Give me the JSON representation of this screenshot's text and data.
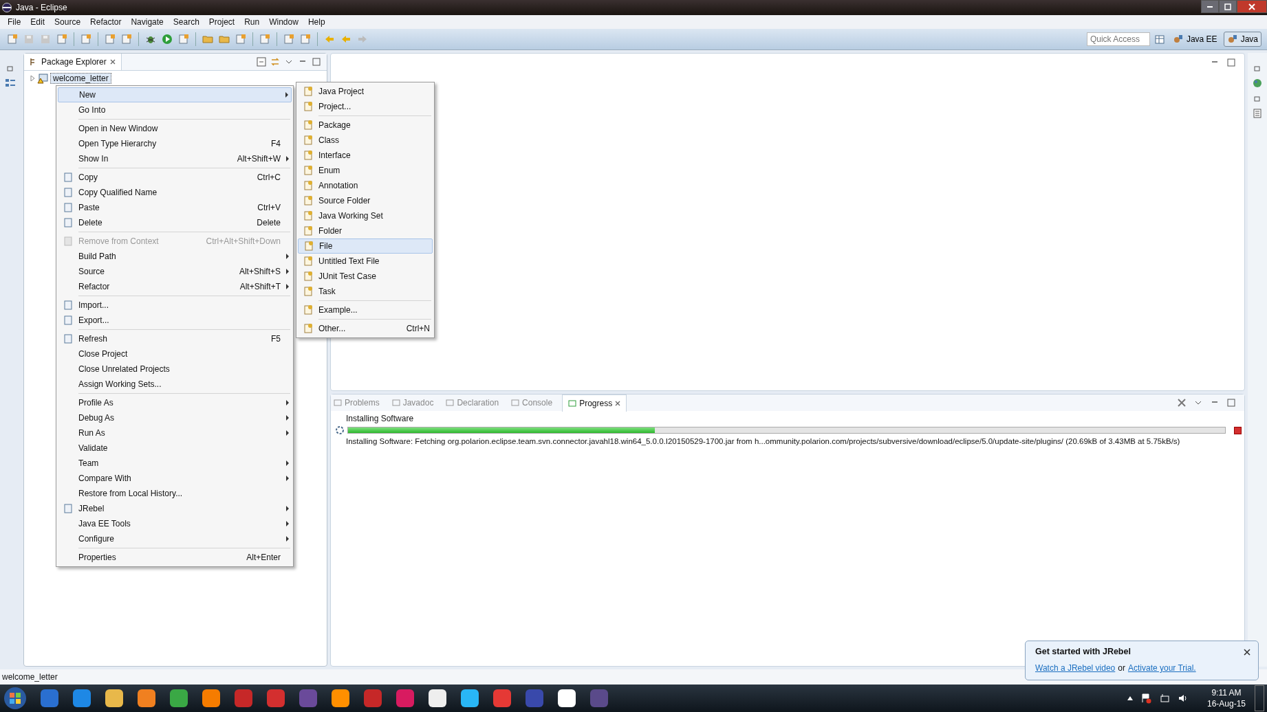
{
  "window": {
    "title": "Java - Eclipse"
  },
  "menubar": [
    "File",
    "Edit",
    "Source",
    "Refactor",
    "Navigate",
    "Search",
    "Project",
    "Run",
    "Window",
    "Help"
  ],
  "quick_access": {
    "placeholder": "Quick Access"
  },
  "perspectives": [
    {
      "label": "Java EE",
      "selected": false
    },
    {
      "label": "Java",
      "selected": true
    }
  ],
  "package_explorer": {
    "title": "Package Explorer",
    "tree": [
      {
        "label": "welcome_letter",
        "expanded": false,
        "selected": true
      }
    ]
  },
  "context_menu": {
    "items": [
      {
        "kind": "item",
        "label": "New",
        "submenu": true,
        "disabled": false,
        "icon": false,
        "selected": true
      },
      {
        "kind": "item",
        "label": "Go Into",
        "submenu": false,
        "disabled": false,
        "icon": false,
        "selected": false
      },
      {
        "kind": "separator"
      },
      {
        "kind": "item",
        "label": "Open in New Window",
        "submenu": false,
        "disabled": false,
        "icon": false,
        "selected": false
      },
      {
        "kind": "item",
        "label": "Open Type Hierarchy",
        "shortcut": "F4",
        "submenu": false,
        "disabled": false,
        "icon": false,
        "selected": false
      },
      {
        "kind": "item",
        "label": "Show In",
        "shortcut": "Alt+Shift+W",
        "submenu": true,
        "disabled": false,
        "icon": false,
        "selected": false
      },
      {
        "kind": "separator"
      },
      {
        "kind": "item",
        "label": "Copy",
        "shortcut": "Ctrl+C",
        "submenu": false,
        "disabled": false,
        "icon": true,
        "selected": false
      },
      {
        "kind": "item",
        "label": "Copy Qualified Name",
        "submenu": false,
        "disabled": false,
        "icon": true,
        "selected": false
      },
      {
        "kind": "item",
        "label": "Paste",
        "shortcut": "Ctrl+V",
        "submenu": false,
        "disabled": false,
        "icon": true,
        "selected": false
      },
      {
        "kind": "item",
        "label": "Delete",
        "shortcut": "Delete",
        "submenu": false,
        "disabled": false,
        "icon": true,
        "selected": false
      },
      {
        "kind": "separator"
      },
      {
        "kind": "item",
        "label": "Remove from Context",
        "shortcut": "Ctrl+Alt+Shift+Down",
        "submenu": false,
        "disabled": true,
        "icon": true,
        "selected": false
      },
      {
        "kind": "item",
        "label": "Build Path",
        "submenu": true,
        "disabled": false,
        "icon": false,
        "selected": false
      },
      {
        "kind": "item",
        "label": "Source",
        "shortcut": "Alt+Shift+S",
        "submenu": true,
        "disabled": false,
        "icon": false,
        "selected": false
      },
      {
        "kind": "item",
        "label": "Refactor",
        "shortcut": "Alt+Shift+T",
        "submenu": true,
        "disabled": false,
        "icon": false,
        "selected": false
      },
      {
        "kind": "separator"
      },
      {
        "kind": "item",
        "label": "Import...",
        "submenu": false,
        "disabled": false,
        "icon": true,
        "selected": false
      },
      {
        "kind": "item",
        "label": "Export...",
        "submenu": false,
        "disabled": false,
        "icon": true,
        "selected": false
      },
      {
        "kind": "separator"
      },
      {
        "kind": "item",
        "label": "Refresh",
        "shortcut": "F5",
        "submenu": false,
        "disabled": false,
        "icon": true,
        "selected": false
      },
      {
        "kind": "item",
        "label": "Close Project",
        "submenu": false,
        "disabled": false,
        "icon": false,
        "selected": false
      },
      {
        "kind": "item",
        "label": "Close Unrelated Projects",
        "submenu": false,
        "disabled": false,
        "icon": false,
        "selected": false
      },
      {
        "kind": "item",
        "label": "Assign Working Sets...",
        "submenu": false,
        "disabled": false,
        "icon": false,
        "selected": false
      },
      {
        "kind": "separator"
      },
      {
        "kind": "item",
        "label": "Profile As",
        "submenu": true,
        "disabled": false,
        "icon": false,
        "selected": false
      },
      {
        "kind": "item",
        "label": "Debug As",
        "submenu": true,
        "disabled": false,
        "icon": false,
        "selected": false
      },
      {
        "kind": "item",
        "label": "Run As",
        "submenu": true,
        "disabled": false,
        "icon": false,
        "selected": false
      },
      {
        "kind": "item",
        "label": "Validate",
        "submenu": false,
        "disabled": false,
        "icon": false,
        "selected": false
      },
      {
        "kind": "item",
        "label": "Team",
        "submenu": true,
        "disabled": false,
        "icon": false,
        "selected": false
      },
      {
        "kind": "item",
        "label": "Compare With",
        "submenu": true,
        "disabled": false,
        "icon": false,
        "selected": false
      },
      {
        "kind": "item",
        "label": "Restore from Local History...",
        "submenu": false,
        "disabled": false,
        "icon": false,
        "selected": false
      },
      {
        "kind": "item",
        "label": "JRebel",
        "submenu": true,
        "disabled": false,
        "icon": true,
        "selected": false
      },
      {
        "kind": "item",
        "label": "Java EE Tools",
        "submenu": true,
        "disabled": false,
        "icon": false,
        "selected": false
      },
      {
        "kind": "item",
        "label": "Configure",
        "submenu": true,
        "disabled": false,
        "icon": false,
        "selected": false
      },
      {
        "kind": "separator"
      },
      {
        "kind": "item",
        "label": "Properties",
        "shortcut": "Alt+Enter",
        "submenu": false,
        "disabled": false,
        "icon": false,
        "selected": false
      }
    ]
  },
  "new_submenu": {
    "items": [
      {
        "kind": "item",
        "label": "Java Project",
        "selected": false
      },
      {
        "kind": "item",
        "label": "Project...",
        "selected": false
      },
      {
        "kind": "separator"
      },
      {
        "kind": "item",
        "label": "Package",
        "selected": false
      },
      {
        "kind": "item",
        "label": "Class",
        "selected": false
      },
      {
        "kind": "item",
        "label": "Interface",
        "selected": false
      },
      {
        "kind": "item",
        "label": "Enum",
        "selected": false
      },
      {
        "kind": "item",
        "label": "Annotation",
        "selected": false
      },
      {
        "kind": "item",
        "label": "Source Folder",
        "selected": false
      },
      {
        "kind": "item",
        "label": "Java Working Set",
        "selected": false
      },
      {
        "kind": "item",
        "label": "Folder",
        "selected": false
      },
      {
        "kind": "item",
        "label": "File",
        "selected": true
      },
      {
        "kind": "item",
        "label": "Untitled Text File",
        "selected": false
      },
      {
        "kind": "item",
        "label": "JUnit Test Case",
        "selected": false
      },
      {
        "kind": "item",
        "label": "Task",
        "selected": false
      },
      {
        "kind": "separator"
      },
      {
        "kind": "item",
        "label": "Example...",
        "selected": false
      },
      {
        "kind": "separator"
      },
      {
        "kind": "item",
        "label": "Other...",
        "shortcut": "Ctrl+N",
        "selected": false
      }
    ]
  },
  "bottom_panel": {
    "tabs": [
      {
        "label": "Problems",
        "selected": false
      },
      {
        "label": "Javadoc",
        "selected": false
      },
      {
        "label": "Declaration",
        "selected": false
      },
      {
        "label": "Console",
        "selected": false
      },
      {
        "label": "Progress",
        "selected": true
      }
    ],
    "progress": {
      "title": "Installing Software",
      "level": 0.35,
      "detail": "Installing Software: Fetching org.polarion.eclipse.team.svn.connector.javahl18.win64_5.0.0.I20150529-1700.jar from h...ommunity.polarion.com/projects/subversive/download/eclipse/5.0/update-site/plugins/ (20.69kB of 3.43MB at 5.75kB/s)"
    }
  },
  "status_bar": {
    "text": "welcome_letter"
  },
  "notification": {
    "title": "Get started with JRebel",
    "link_1": "Watch a JRebel video",
    "joiner": "or",
    "link_2": "Activate your Trial."
  },
  "taskbar": {
    "time": "9:11 AM",
    "date": "16-Aug-15"
  }
}
